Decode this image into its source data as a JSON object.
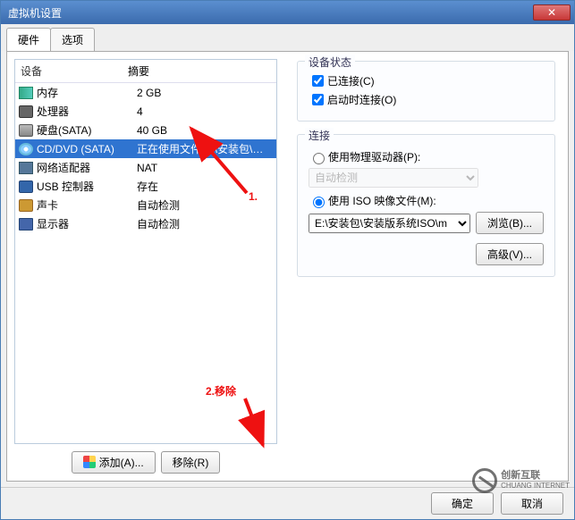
{
  "window": {
    "title": "虚拟机设置",
    "close_glyph": "✕"
  },
  "tabs": {
    "hardware": "硬件",
    "options": "选项"
  },
  "columns": {
    "device": "设备",
    "summary": "摘要"
  },
  "devices": [
    {
      "icon": "ic-mem",
      "name": "内存",
      "summary": "2 GB"
    },
    {
      "icon": "ic-cpu",
      "name": "处理器",
      "summary": "4"
    },
    {
      "icon": "ic-hdd",
      "name": "硬盘(SATA)",
      "summary": "40 GB"
    },
    {
      "icon": "ic-cd",
      "name": "CD/DVD (SATA)",
      "summary": "正在使用文件 E:\\安装包\\安装版系统…",
      "selected": true
    },
    {
      "icon": "ic-nic",
      "name": "网络适配器",
      "summary": "NAT"
    },
    {
      "icon": "ic-usb",
      "name": "USB 控制器",
      "summary": "存在"
    },
    {
      "icon": "ic-snd",
      "name": "声卡",
      "summary": "自动检测"
    },
    {
      "icon": "ic-mon",
      "name": "显示器",
      "summary": "自动检测"
    }
  ],
  "left_buttons": {
    "add": "添加(A)...",
    "remove": "移除(R)"
  },
  "status_group": {
    "legend": "设备状态",
    "connected": "已连接(C)",
    "connect_at_power_on": "启动时连接(O)"
  },
  "connect_group": {
    "legend": "连接",
    "use_physical": "使用物理驱动器(P):",
    "auto_detect": "自动检测",
    "use_iso": "使用 ISO 映像文件(M):",
    "iso_path": "E:\\安装包\\安装版系统ISO\\m",
    "browse": "浏览(B)...",
    "advanced": "高级(V)..."
  },
  "bottom": {
    "ok": "确定",
    "cancel": "取消"
  },
  "annotations": {
    "step1": "1.",
    "step2": "2.移除"
  },
  "watermark": {
    "brand": "创新互联",
    "sub": "CHUANG INTERNET"
  }
}
